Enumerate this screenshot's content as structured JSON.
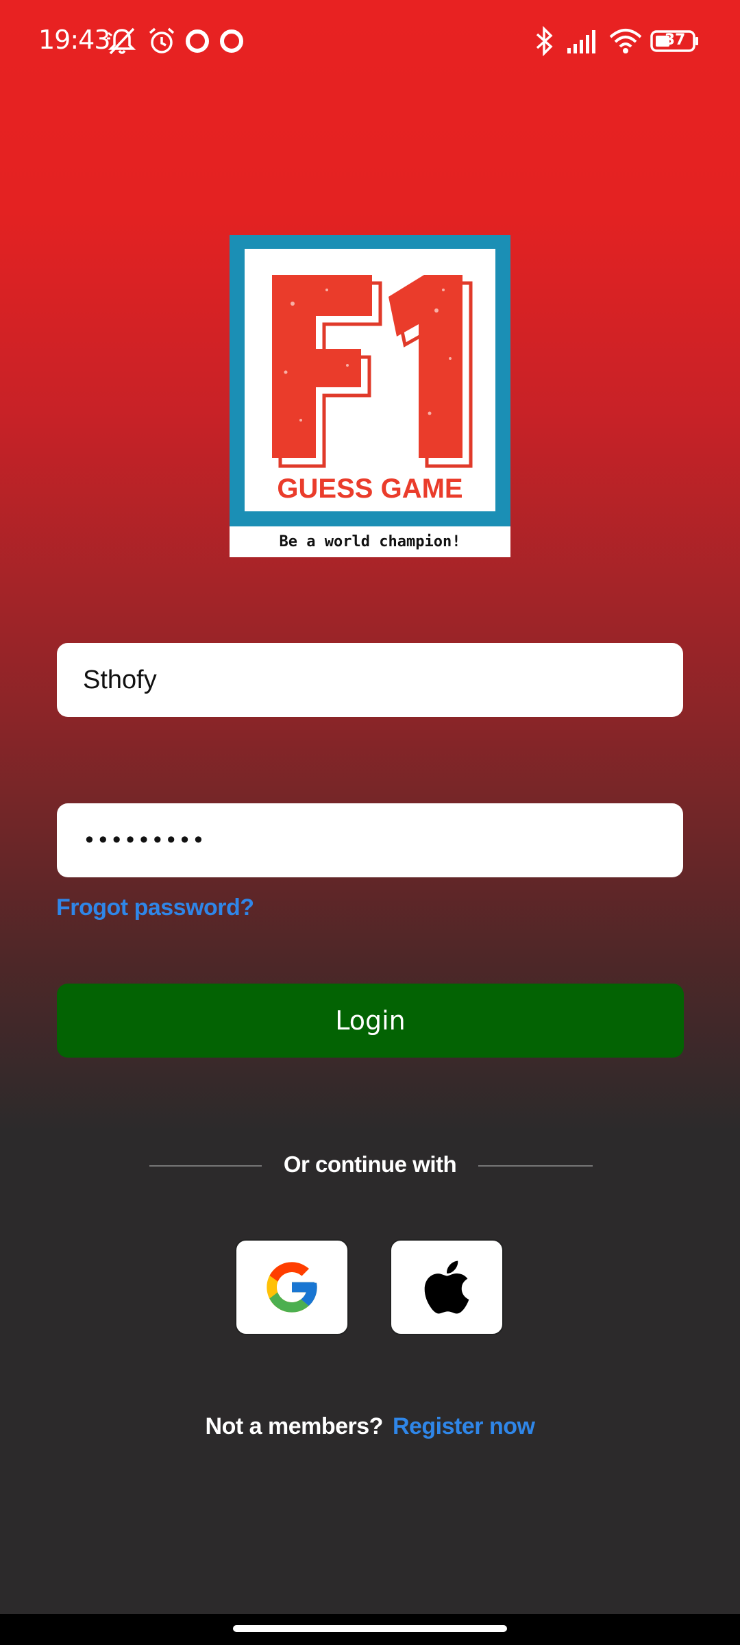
{
  "status_bar": {
    "time": "19:43",
    "battery": "37"
  },
  "logo": {
    "title": "F1",
    "subtitle": "GUESS GAME",
    "tagline": "Be a world champion!"
  },
  "form": {
    "username_value": "Sthofy",
    "password_value": "•••••••••",
    "forgot_label": "Frogot password?",
    "login_label": "Login"
  },
  "social": {
    "divider_label": "Or continue with",
    "google_icon": "google-icon",
    "apple_icon": "apple-icon"
  },
  "footer": {
    "question": "Not a members?",
    "register_label": "Register now"
  },
  "colors": {
    "accent_link": "#2f86e8",
    "login_button": "#036303",
    "background_top": "#e82222",
    "background_bottom": "#2c2a2b"
  }
}
